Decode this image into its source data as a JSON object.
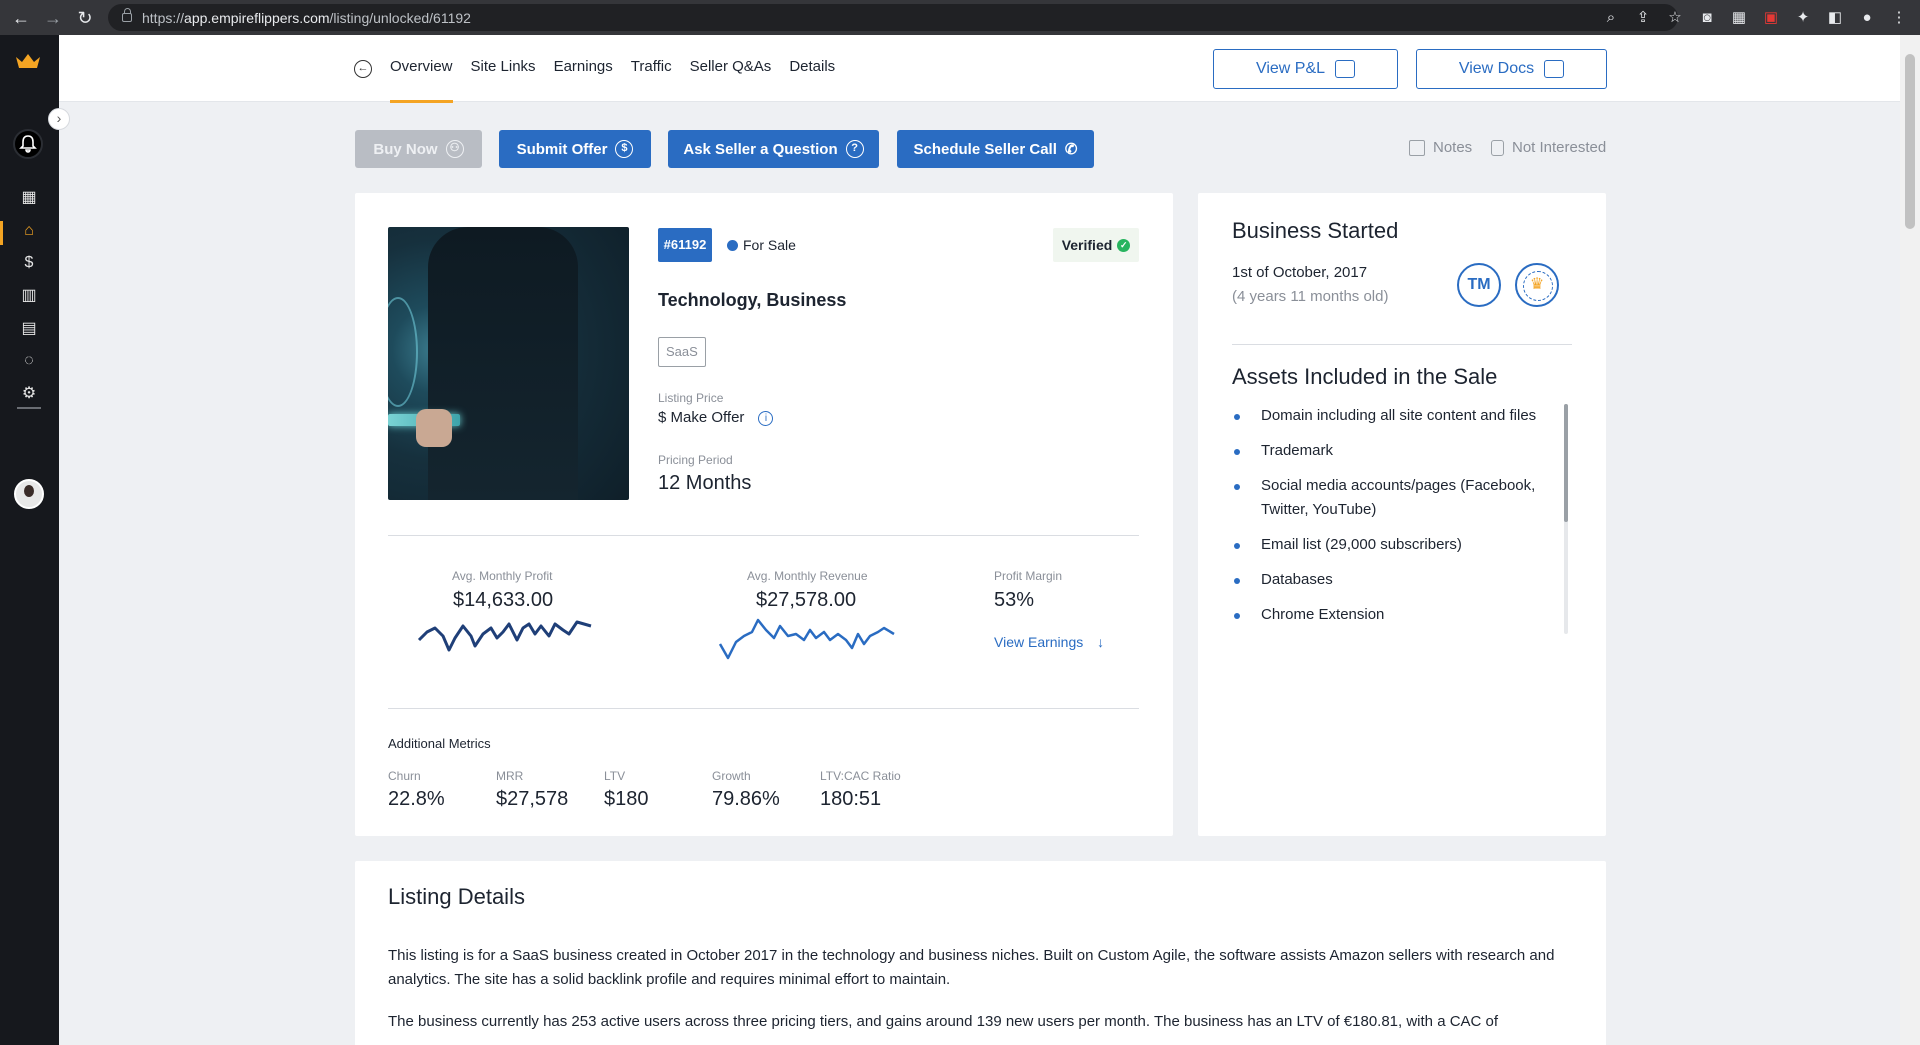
{
  "browser": {
    "url_prefix": "https://",
    "url_host": "app.empireflippers.com",
    "url_path": "/listing/unlocked/61192"
  },
  "tabs": [
    "Overview",
    "Site Links",
    "Earnings",
    "Traffic",
    "Seller Q&As",
    "Details"
  ],
  "top_buttons": {
    "pnl": "View P&L",
    "docs": "View Docs"
  },
  "actions": {
    "buy_now": "Buy Now",
    "submit_offer": "Submit Offer",
    "ask_question": "Ask Seller a Question",
    "schedule_call": "Schedule Seller Call",
    "notes": "Notes",
    "not_interested": "Not Interested"
  },
  "listing": {
    "id": "#61192",
    "status": "For Sale",
    "verified": "Verified",
    "niche": "Technology, Business",
    "model": "SaaS",
    "price_label": "Listing Price",
    "price_value": "$ Make Offer",
    "period_label": "Pricing Period",
    "period_value": "12 Months"
  },
  "metrics": {
    "profit_label": "Avg. Monthly Profit",
    "profit_value": "$14,633.00",
    "revenue_label": "Avg. Monthly Revenue",
    "revenue_value": "$27,578.00",
    "margin_label": "Profit Margin",
    "margin_value": "53%",
    "view_earnings": "View Earnings"
  },
  "additional": {
    "title": "Additional Metrics",
    "items": [
      {
        "label": "Churn",
        "value": "22.8%"
      },
      {
        "label": "MRR",
        "value": "$27,578"
      },
      {
        "label": "LTV",
        "value": "$180"
      },
      {
        "label": "Growth",
        "value": "79.86%"
      },
      {
        "label": "LTV:CAC Ratio",
        "value": "180:51"
      }
    ]
  },
  "business": {
    "title": "Business Started",
    "date": "1st of October, 2017",
    "age": "(4 years 11 months old)",
    "tm": "TM"
  },
  "assets": {
    "title": "Assets Included in the Sale",
    "items": [
      "Domain including all site content and files",
      "Trademark",
      "Social media accounts/pages (Facebook, Twitter, YouTube)",
      "Email list (29,000 subscribers)",
      "Databases",
      "Chrome Extension"
    ]
  },
  "details": {
    "title": "Listing Details",
    "p1": "This listing is for a SaaS business created in October 2017 in the technology and business niches. Built on Custom Agile, the software assists Amazon sellers with research and analytics. The site has a solid backlink profile and requires minimal effort to maintain.",
    "p2": "The business currently has 253 active users across three pricing tiers, and gains around 139 new users per month. The business has an LTV of €180.81, with a CAC of"
  },
  "colors": {
    "accent": "#2a6cc2",
    "brand": "#f4a423",
    "rail": "#16181d"
  }
}
